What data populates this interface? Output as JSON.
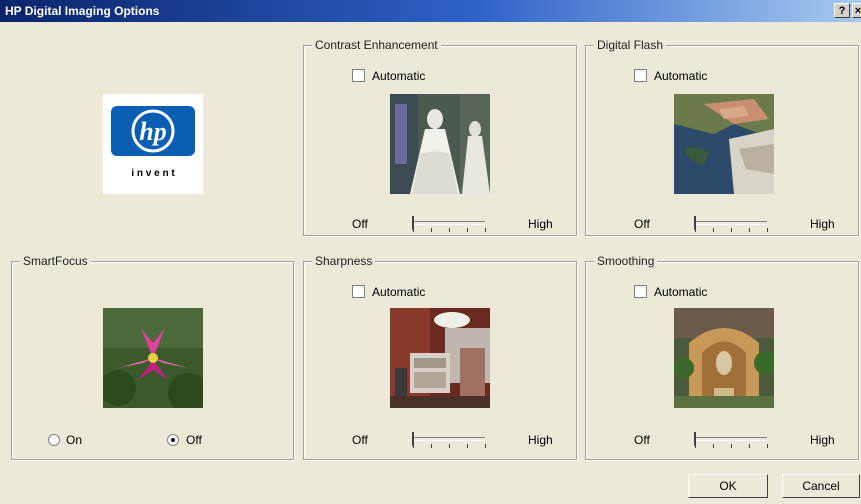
{
  "window": {
    "title": "HP Digital Imaging Options",
    "help_label": "?",
    "close_label": "×"
  },
  "logo": {
    "mark": "hp",
    "tagline": "i n v e n t"
  },
  "groups": {
    "contrast": {
      "title": "Contrast Enhancement",
      "checkbox": "Automatic",
      "off": "Off",
      "high": "High",
      "level": 0
    },
    "flash": {
      "title": "Digital Flash",
      "checkbox": "Automatic",
      "off": "Off",
      "high": "High",
      "level": 0
    },
    "smartfocus": {
      "title": "SmartFocus",
      "on": "On",
      "off": "Off",
      "selected": "Off"
    },
    "sharpness": {
      "title": "Sharpness",
      "checkbox": "Automatic",
      "off": "Off",
      "high": "High",
      "level": 0
    },
    "smoothing": {
      "title": "Smoothing",
      "checkbox": "Automatic",
      "off": "Off",
      "high": "High",
      "level": 0
    }
  },
  "buttons": {
    "ok": "OK",
    "cancel": "Cancel"
  },
  "colors": {
    "title_bar": "#0a246a",
    "hp_blue": "#0a5fb4",
    "dialog_bg": "#ece9d8"
  }
}
